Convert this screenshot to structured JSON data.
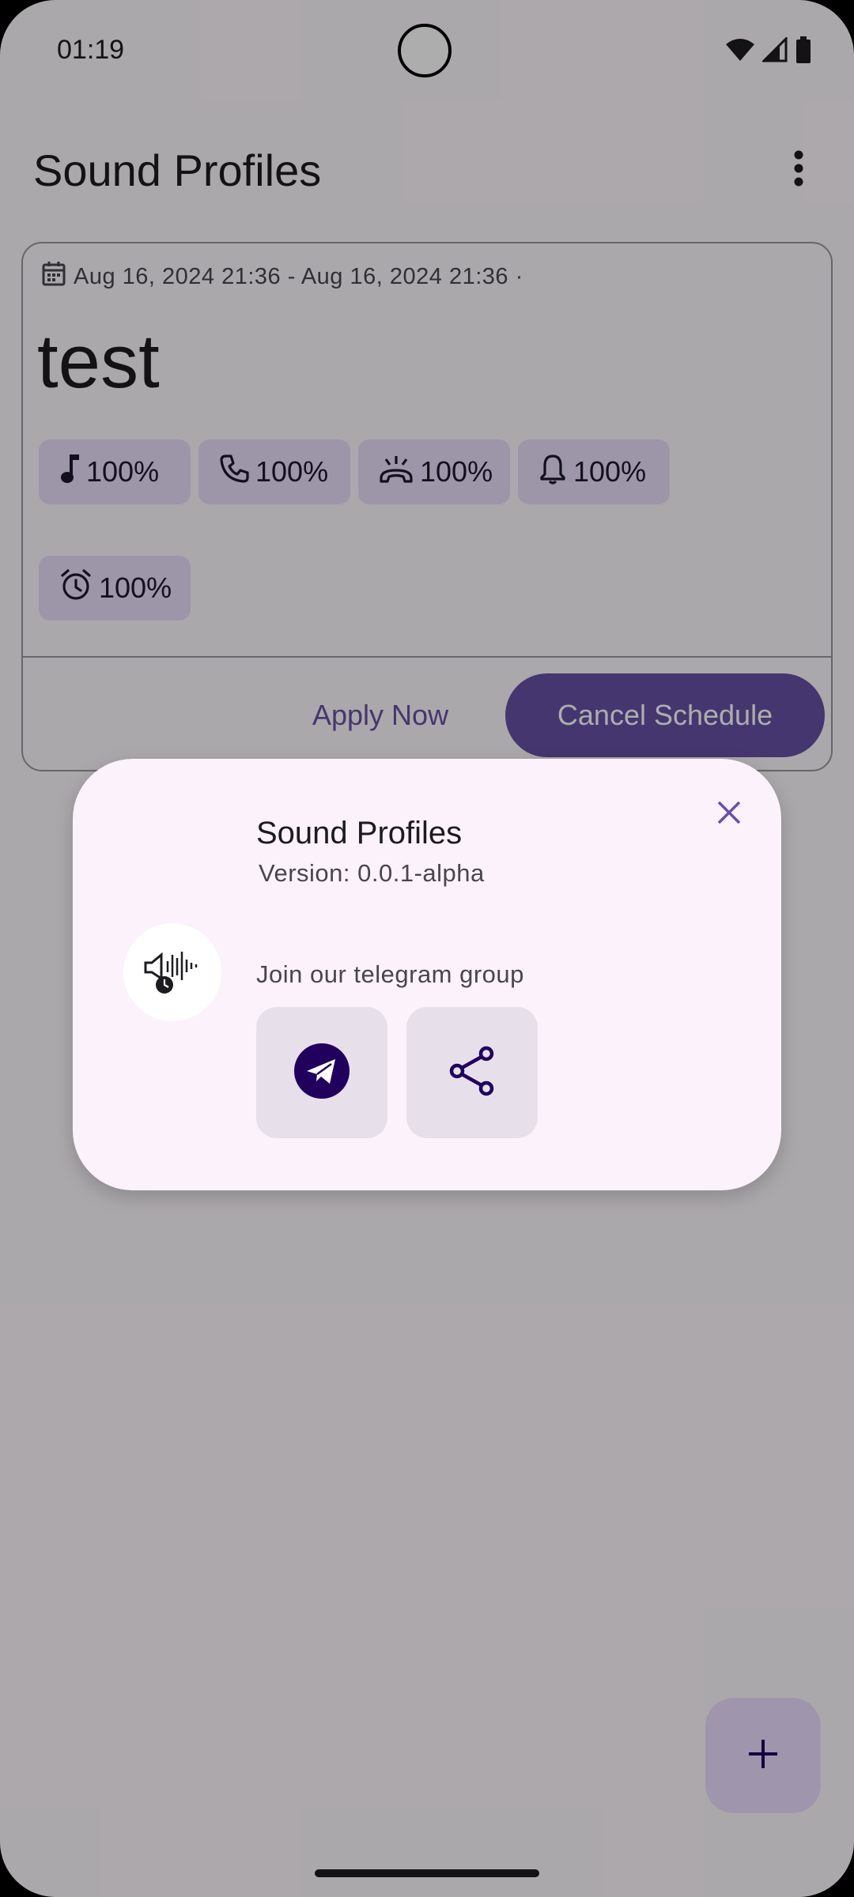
{
  "status_bar": {
    "time": "01:19"
  },
  "app_bar": {
    "title": "Sound Profiles"
  },
  "profile_card": {
    "date_range": "Aug 16, 2024 21:36 - Aug 16, 2024 21:36 ·",
    "name": "test",
    "volumes": {
      "music": "100%",
      "call": "100%",
      "ring": "100%",
      "notification": "100%",
      "alarm": "100%"
    },
    "apply_label": "Apply Now",
    "cancel_label": "Cancel Schedule"
  },
  "about_dialog": {
    "title": "Sound Profiles",
    "version": "Version: 0.0.1-alpha",
    "join_text": "Join our telegram group"
  },
  "colors": {
    "primary": "#6750a4",
    "chip_bg": "#e8def8",
    "fab_bg": "#eaddff",
    "dialog_bg": "#fbf2fb",
    "telegram_circle": "#21005d"
  }
}
